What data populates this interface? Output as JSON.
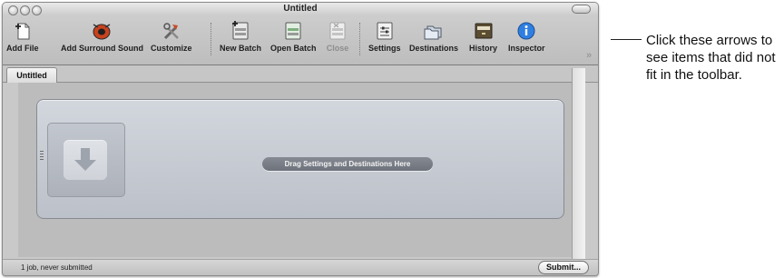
{
  "window": {
    "title": "Untitled"
  },
  "toolbar": {
    "items": [
      {
        "label": "Add File",
        "icon": "add-file-icon"
      },
      {
        "label": "Add Surround Sound",
        "icon": "surround-sound-icon"
      },
      {
        "label": "Customize",
        "icon": "tools-icon"
      },
      {
        "label": "New Batch",
        "icon": "new-batch-icon"
      },
      {
        "label": "Open Batch",
        "icon": "open-batch-icon"
      },
      {
        "label": "Close",
        "icon": "close-batch-icon",
        "enabled": false
      },
      {
        "label": "Settings",
        "icon": "settings-icon"
      },
      {
        "label": "Destinations",
        "icon": "folders-icon"
      },
      {
        "label": "History",
        "icon": "drawer-icon"
      },
      {
        "label": "Inspector",
        "icon": "info-icon"
      }
    ],
    "overflow_glyph": "»"
  },
  "tabs": [
    {
      "label": "Untitled",
      "active": true
    }
  ],
  "batch": {
    "drag_hint": "Drag Settings and Destinations Here"
  },
  "status": {
    "text": "1 job, never submitted",
    "submit_label": "Submit..."
  },
  "callout": {
    "text": "Click these arrows to see items that did not fit in the toolbar."
  },
  "colors": {
    "accent_blue": "#2f7fe0",
    "pill_gray": "#767b84",
    "sound_red": "#c8421e"
  }
}
